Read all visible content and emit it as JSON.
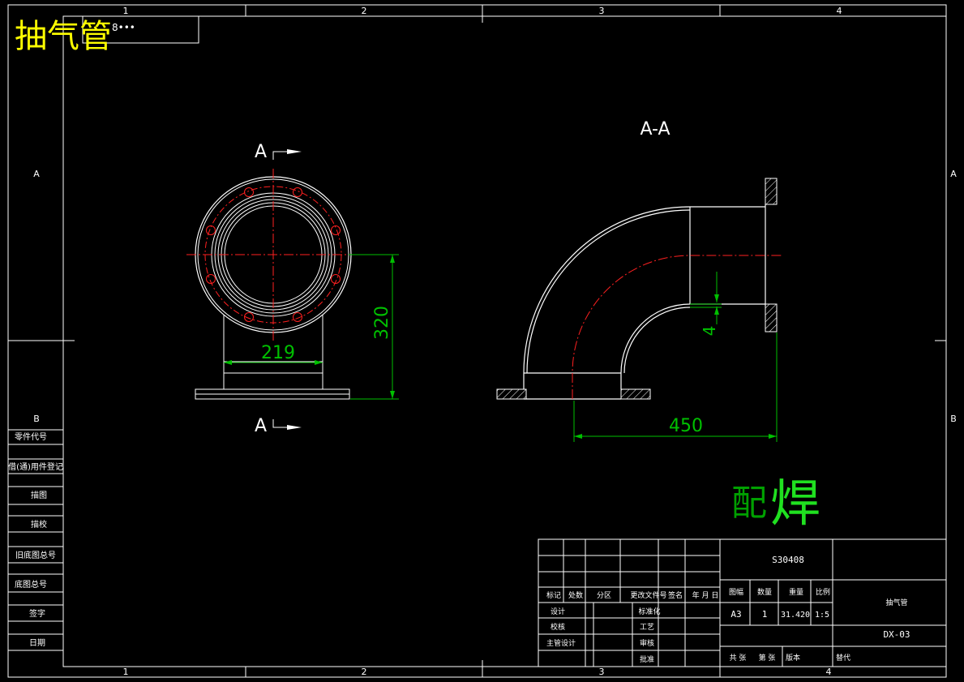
{
  "title_overlay": "抽气管",
  "title_box_text": "8•••",
  "zones": {
    "top": [
      "1",
      "2",
      "3",
      "4"
    ],
    "bottom": [
      "1",
      "2",
      "3",
      "4"
    ],
    "left": [
      "A",
      "B"
    ],
    "right": [
      "A",
      "B"
    ]
  },
  "views": {
    "section_top": "A",
    "section_bottom": "A",
    "section_title": "A-A",
    "dim_width": "219",
    "dim_height": "320",
    "dim_length": "450",
    "dim_thickness": "4"
  },
  "stamp": {
    "left": "配",
    "right": "焊"
  },
  "left_panel": [
    "零件代号",
    "借(通)用件登记",
    "描图",
    "描校",
    "旧底图总号",
    "底图总号",
    "签字",
    "日期"
  ],
  "title_block": {
    "rev_headers": [
      "标记",
      "处数",
      "分区",
      "更改文件号",
      "签名",
      "年 月 日"
    ],
    "approvals": [
      "设计",
      "校核",
      "主管设计"
    ],
    "approvals2": [
      "标准化",
      "工艺",
      "审核",
      "批准"
    ],
    "material": "S30408",
    "attr_headers": [
      "图幅",
      "数量",
      "重量",
      "比例"
    ],
    "attr_values": [
      "A3",
      "1",
      "31.420",
      "1:5"
    ],
    "part_name": "抽气管",
    "drawing_no": "DX-03",
    "footer": [
      "共 张",
      "第 张",
      "版本",
      "替代"
    ]
  }
}
